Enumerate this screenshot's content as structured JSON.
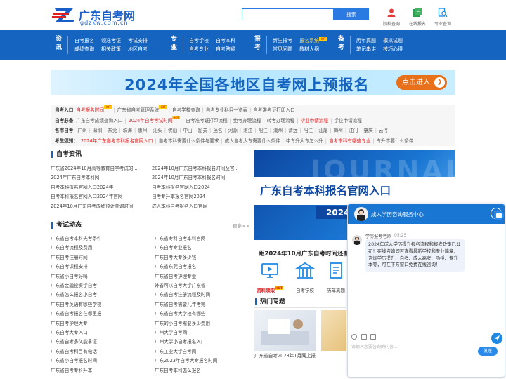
{
  "header": {
    "logo_text": "广东自考网",
    "logo_url": "gdzkw.com.cn",
    "search_placeholder": "",
    "search_button": "搜索",
    "icons": [
      {
        "label": "院校查询",
        "icon": "person-icon"
      },
      {
        "label": "在线报名",
        "icon": "signup-icon"
      },
      {
        "label": "专业查询",
        "icon": "search-doc-icon"
      }
    ]
  },
  "nav": {
    "groups": [
      {
        "cat": "资讯",
        "links": [
          "自考报名",
          "领准考证",
          "考试安排",
          "成绩查询",
          "相关政策",
          "地区自考"
        ]
      },
      {
        "cat": "专业",
        "links": [
          "自考学校",
          "自考本科",
          "自考专业",
          "自考答疑"
        ]
      },
      {
        "cat": "报考",
        "links": [
          "新生报考",
          "报名系统",
          "常见问题",
          "教材大纲"
        ],
        "hot": "HOT"
      },
      {
        "cat": "备考",
        "links": [
          "历年真题",
          "模拟试题",
          "笔记串讲",
          "技巧心得"
        ]
      }
    ]
  },
  "banner": {
    "title": "2024年全国各地区自考网上预报名",
    "button": "点击进入"
  },
  "quick_links": {
    "row1": {
      "label": "自考入口",
      "items": [
        "自考报名时间",
        "广东省自考管理系统",
        "自考学校查询",
        "自考专业科目一览表",
        "自考准考证打印入口"
      ]
    },
    "row2": {
      "label": "自考必备",
      "items": [
        "广东自考成绩查询入口",
        "2024年自考考试时间",
        "自考准考证打印流程",
        "免考办理流程",
        "转考办理流程",
        "毕业申请流程",
        "学位申请流程"
      ]
    },
    "row3": {
      "label": "各市自考",
      "items": [
        "广州",
        "深圳",
        "东莞",
        "珠海",
        "惠州",
        "汕头",
        "佛山",
        "中山",
        "韶关",
        "茂名",
        "河源",
        "湛江",
        "阳江",
        "潮州",
        "清远",
        "阳江",
        "汕尾",
        "梅州",
        "江门",
        "肇庆",
        "云浮"
      ]
    },
    "row4": {
      "label": "考生须知：",
      "items": [
        "2024年广东自考本科报名官网入口",
        "自考本科需要什么条件与要求",
        "成人自考大专需要什么条件",
        "中专升大专怎么升",
        "自考本科有哪些专业",
        "专升本要什么条件"
      ]
    }
  },
  "news": {
    "title": "自考资讯",
    "left": [
      "广东省2024年10月高等教育自学考试的...",
      "2024年广东自考本科网",
      "自考本科报名官网入口2024年",
      "自考本科报名官网入口2024年官网",
      "2024年10月广东自考成绩预计查询时间"
    ],
    "right": [
      "2024年10月广东自考本科报名时间及官...",
      "2024年10月广东自考本科报名时间",
      "自考本科报名官网入口2024",
      "自考专升本报名官网2024",
      "成人本科自考报名入口官网"
    ]
  },
  "exam": {
    "title": "考试动态",
    "more": "更多>>",
    "left": [
      "广东省自考本科先考条件",
      "广东自考流程及费用",
      "广东自考注册时间",
      "广东自考课程安排",
      "广东省小自考好吗",
      "广东省金融投资学自考",
      "广东省怎么报名小自考",
      "广东自考英语有哪些学校",
      "广东省自考报名在哪里报",
      "广东自考护理大专",
      "广东自考大专入口",
      "广东省自考多久能拿证",
      "广东省自考科目有电话",
      "广东省小自考报名时间",
      "广东省自考专科升本"
    ],
    "right": [
      "广东省专科自考本科官网",
      "广东自考专业报名",
      "广东自考大专多少钱",
      "广东省东莞自考报名",
      "广东省自考护理专业",
      "外省可以自考大学广东省",
      "广东省自考注册流程及时间",
      "广东省自考需要几年考完",
      "广东省自考大学校有哪些",
      "广东的小自考需要多少费用",
      "广州大学自考网",
      "广州大学小自考报名入口",
      "广东工业大学自考网",
      "广东2023年自考大专报名时间",
      "广东自考本科怎么报名"
    ]
  },
  "promo": {
    "watermark": "JOURNAL",
    "title": "广东自考本科报名官网入口",
    "year": "2024"
  },
  "countdown": "距2024年10月广东自考时间还有",
  "tools": [
    {
      "label": "资料领取",
      "icon": "data-collect-icon",
      "hot": "HOT"
    },
    {
      "label": "自考学校",
      "icon": "school-icon"
    },
    {
      "label": "历年真题",
      "icon": "exam-paper-icon"
    }
  ],
  "hot_topics": {
    "title": "热门专题",
    "item1": "广东省自考2023年1月网上报"
  },
  "chat": {
    "header": "成人学历咨询服务中心",
    "agent": "学历报考老师",
    "time": "05:25",
    "message": "2024年成人学历提升报名流程和报考政策已公布！在线咨询即可查看最新学校和专业简章，咨询学历提升、自考、成人高考、函授、专升本等，可在下方窗口免费在线咨询！",
    "input_placeholder": "请输入您要咨询的内容...",
    "send": "发送",
    "close": "×"
  },
  "colors": {
    "brand": "#1565c0",
    "accent": "#2a7ae2",
    "hot": "#e02020",
    "orange": "#e8701a"
  }
}
